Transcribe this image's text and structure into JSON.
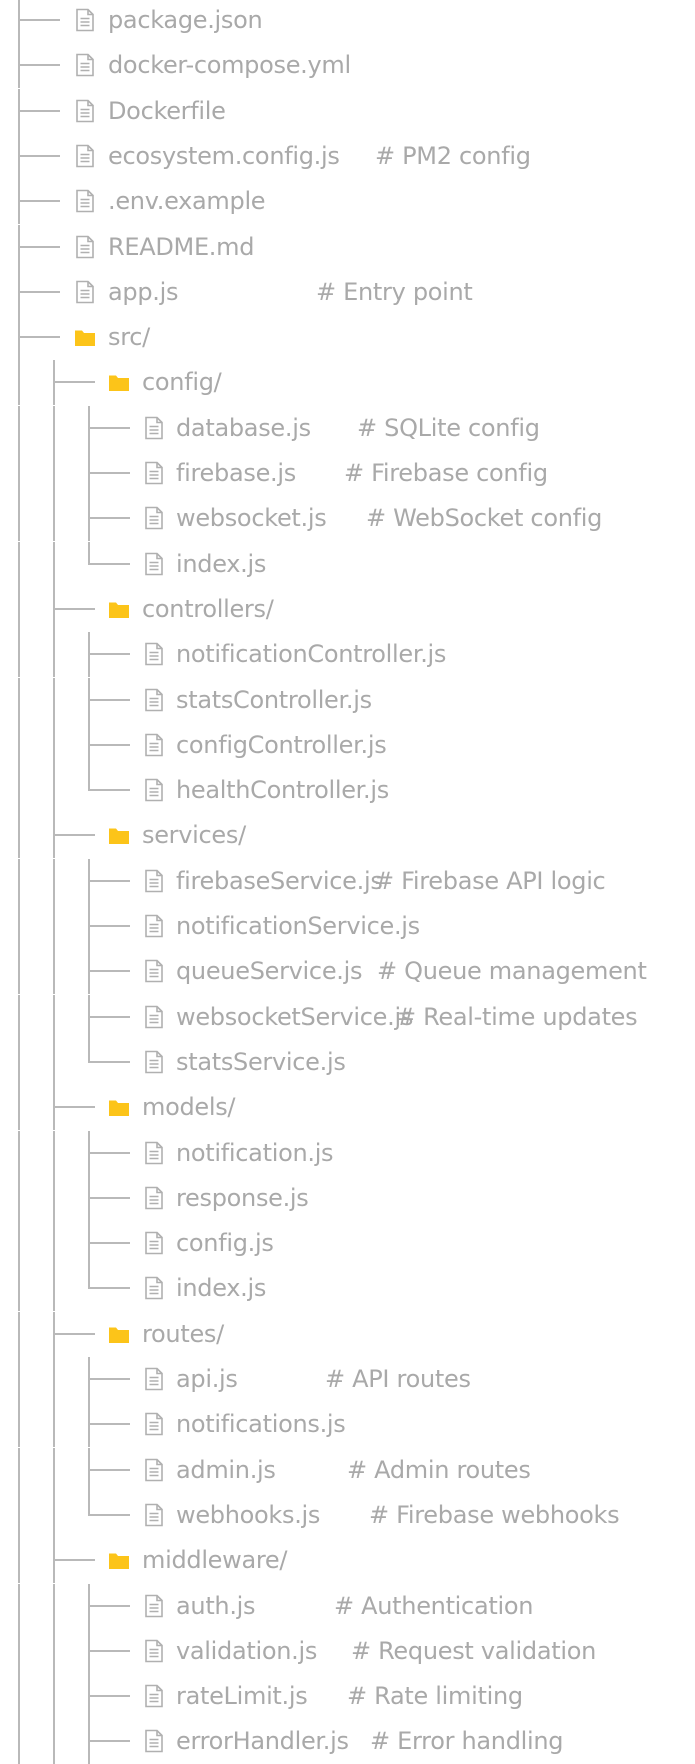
{
  "colors": {
    "line": "#b9b9b9",
    "text": "#a9a9a9",
    "folder": "#fcc419",
    "file_icon": "#b0b0b0"
  },
  "icons": {
    "file": "file-icon",
    "folder": "folder-icon"
  },
  "tree": [
    {
      "depth": 0,
      "type": "file",
      "name": "package.json",
      "comment": ""
    },
    {
      "depth": 0,
      "type": "file",
      "name": "docker-compose.yml",
      "comment": ""
    },
    {
      "depth": 0,
      "type": "file",
      "name": "Dockerfile",
      "comment": ""
    },
    {
      "depth": 0,
      "type": "file",
      "name": "ecosystem.config.js",
      "comment": "# PM2 config"
    },
    {
      "depth": 0,
      "type": "file",
      "name": ".env.example",
      "comment": ""
    },
    {
      "depth": 0,
      "type": "file",
      "name": "README.md",
      "comment": ""
    },
    {
      "depth": 0,
      "type": "file",
      "name": "app.js",
      "comment": "# Entry point"
    },
    {
      "depth": 0,
      "type": "folder",
      "name": "src/",
      "comment": ""
    },
    {
      "depth": 1,
      "type": "folder",
      "name": "config/",
      "comment": ""
    },
    {
      "depth": 2,
      "type": "file",
      "name": "database.js",
      "comment": "# SQLite config"
    },
    {
      "depth": 2,
      "type": "file",
      "name": "firebase.js",
      "comment": "# Firebase config"
    },
    {
      "depth": 2,
      "type": "file",
      "name": "websocket.js",
      "comment": "# WebSocket config"
    },
    {
      "depth": 2,
      "type": "file",
      "name": "index.js",
      "comment": "",
      "last": true
    },
    {
      "depth": 1,
      "type": "folder",
      "name": "controllers/",
      "comment": ""
    },
    {
      "depth": 2,
      "type": "file",
      "name": "notificationController.js",
      "comment": ""
    },
    {
      "depth": 2,
      "type": "file",
      "name": "statsController.js",
      "comment": ""
    },
    {
      "depth": 2,
      "type": "file",
      "name": "configController.js",
      "comment": ""
    },
    {
      "depth": 2,
      "type": "file",
      "name": "healthController.js",
      "comment": "",
      "last": true
    },
    {
      "depth": 1,
      "type": "folder",
      "name": "services/",
      "comment": ""
    },
    {
      "depth": 2,
      "type": "file",
      "name": "firebaseService.js",
      "comment": "# Firebase API logic"
    },
    {
      "depth": 2,
      "type": "file",
      "name": "notificationService.js",
      "comment": ""
    },
    {
      "depth": 2,
      "type": "file",
      "name": "queueService.js",
      "comment": "# Queue management"
    },
    {
      "depth": 2,
      "type": "file",
      "name": "websocketService.js",
      "comment": "# Real-time updates"
    },
    {
      "depth": 2,
      "type": "file",
      "name": "statsService.js",
      "comment": "",
      "last": true
    },
    {
      "depth": 1,
      "type": "folder",
      "name": "models/",
      "comment": ""
    },
    {
      "depth": 2,
      "type": "file",
      "name": "notification.js",
      "comment": ""
    },
    {
      "depth": 2,
      "type": "file",
      "name": "response.js",
      "comment": ""
    },
    {
      "depth": 2,
      "type": "file",
      "name": "config.js",
      "comment": ""
    },
    {
      "depth": 2,
      "type": "file",
      "name": "index.js",
      "comment": "",
      "last": true
    },
    {
      "depth": 1,
      "type": "folder",
      "name": "routes/",
      "comment": ""
    },
    {
      "depth": 2,
      "type": "file",
      "name": "api.js",
      "comment": "# API routes"
    },
    {
      "depth": 2,
      "type": "file",
      "name": "notifications.js",
      "comment": ""
    },
    {
      "depth": 2,
      "type": "file",
      "name": "admin.js",
      "comment": "# Admin routes"
    },
    {
      "depth": 2,
      "type": "file",
      "name": "webhooks.js",
      "comment": "# Firebase webhooks",
      "last": true
    },
    {
      "depth": 1,
      "type": "folder",
      "name": "middleware/",
      "comment": ""
    },
    {
      "depth": 2,
      "type": "file",
      "name": "auth.js",
      "comment": "# Authentication"
    },
    {
      "depth": 2,
      "type": "file",
      "name": "validation.js",
      "comment": "# Request validation"
    },
    {
      "depth": 2,
      "type": "file",
      "name": "rateLimit.js",
      "comment": "# Rate limiting"
    },
    {
      "depth": 2,
      "type": "file",
      "name": "errorHandler.js",
      "comment": "# Error handling"
    }
  ]
}
